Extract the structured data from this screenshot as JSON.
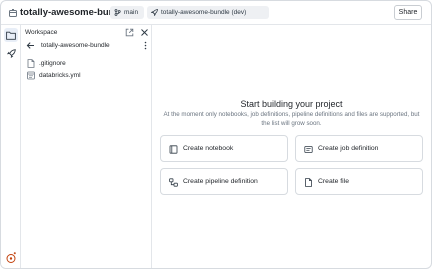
{
  "header": {
    "title": "totally-awesome-bundle",
    "branch": "main",
    "target": "totally-awesome-bundle (dev)",
    "share_label": "Share"
  },
  "sidebar": {
    "panel_title": "Workspace",
    "folder_name": "totally-awesome-bundle",
    "files": [
      {
        "name": ".gitignore",
        "icon": "file-icon"
      },
      {
        "name": "databricks.yml",
        "icon": "yaml-file-icon"
      }
    ]
  },
  "main": {
    "title": "Start building your project",
    "subtitle_line1": "At the moment only notebooks, job definitions, pipeline definitions and files are supported, but",
    "subtitle_line2": "the list will grow soon.",
    "actions": [
      {
        "label": "Create notebook",
        "icon": "notebook-icon"
      },
      {
        "label": "Create job definition",
        "icon": "job-icon"
      },
      {
        "label": "Create pipeline definition",
        "icon": "pipeline-icon"
      },
      {
        "label": "Create file",
        "icon": "file-icon"
      }
    ]
  },
  "colors": {
    "border": "#d7dbe0",
    "muted_text": "#6b7580",
    "chip_bg": "#eef0f3",
    "active_rail": "#e8eef7",
    "bug_icon": "#c2410c"
  }
}
